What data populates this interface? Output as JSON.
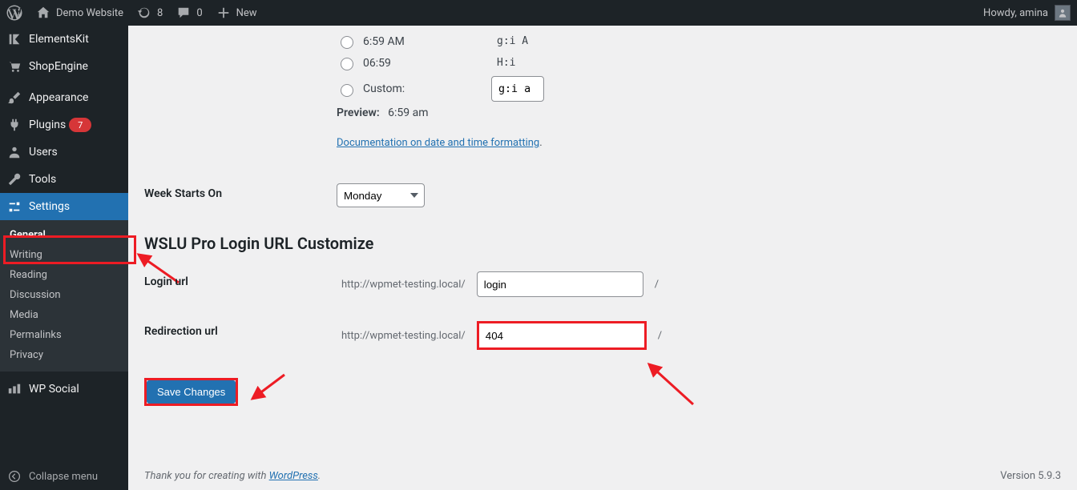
{
  "adminbar": {
    "site_name": "Demo Website",
    "updates_count": "8",
    "comments_count": "0",
    "new_label": "New",
    "howdy_prefix": "Howdy,",
    "user_name": "amina"
  },
  "menu": {
    "elementskit": "ElementsKit",
    "shopengine": "ShopEngine",
    "appearance": "Appearance",
    "plugins": "Plugins",
    "plugins_badge": "7",
    "users": "Users",
    "tools": "Tools",
    "settings": "Settings",
    "wpsocial": "WP Social",
    "collapse": "Collapse menu"
  },
  "submenu": {
    "general": "General",
    "writing": "Writing",
    "reading": "Reading",
    "discussion": "Discussion",
    "media": "Media",
    "permalinks": "Permalinks",
    "privacy": "Privacy"
  },
  "time_format": {
    "opt1_label": "6:59 AM",
    "opt1_code": "g:i A",
    "opt2_label": "06:59",
    "opt2_code": "H:i",
    "opt3_label": "Custom:",
    "custom_value": "g:i a",
    "preview_label": "Preview:",
    "preview_value": "6:59 am",
    "doc_link": "Documentation on date and time formatting"
  },
  "week": {
    "label": "Week Starts On",
    "value": "Monday"
  },
  "wslu": {
    "heading": "WSLU Pro Login URL Customize",
    "login_label": "Login url",
    "login_prefix": "http://wpmet-testing.local/",
    "login_value": "login",
    "login_suffix": "/",
    "redir_label": "Redirection url",
    "redir_prefix": "http://wpmet-testing.local/",
    "redir_value": "404",
    "redir_suffix": "/"
  },
  "save_label": "Save Changes",
  "footer": {
    "thanks_pre": "Thank you for creating with ",
    "thanks_link": "WordPress",
    "thanks_post": ".",
    "version": "Version 5.9.3"
  }
}
